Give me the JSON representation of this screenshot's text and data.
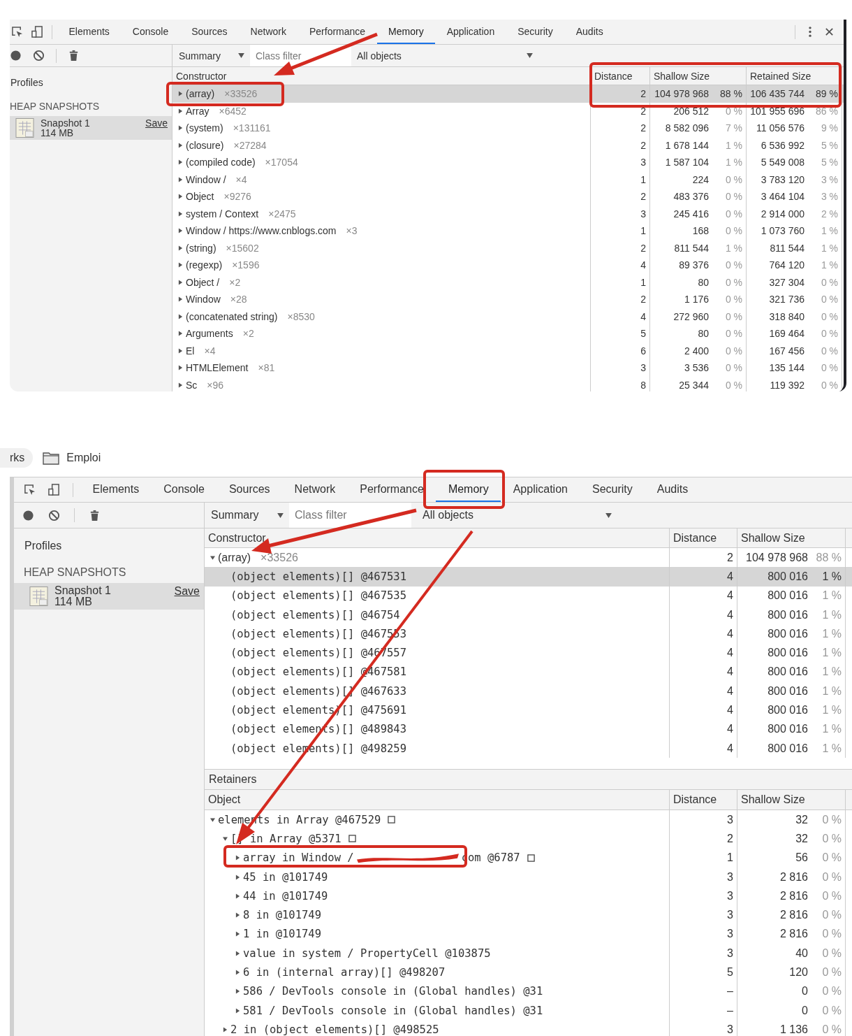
{
  "panels": [
    {
      "tabbar_controls": true,
      "tabs": [
        {
          "label": "Elements",
          "selected": false
        },
        {
          "label": "Console",
          "selected": false
        },
        {
          "label": "Sources",
          "selected": false
        },
        {
          "label": "Network",
          "selected": false
        },
        {
          "label": "Performance",
          "selected": false
        },
        {
          "label": "Memory",
          "selected": true
        },
        {
          "label": "Application",
          "selected": false
        },
        {
          "label": "Security",
          "selected": false
        },
        {
          "label": "Audits",
          "selected": false
        }
      ],
      "toolbar": {
        "view": "Summary",
        "filter_placeholder": "Class filter",
        "scope": "All objects"
      },
      "sidebar": {
        "title": "Profiles",
        "section": "HEAP SNAPSHOTS",
        "snapshot": {
          "name": "Snapshot 1",
          "size": "114 MB",
          "action": "Save",
          "selected": true
        }
      },
      "tables": [
        {
          "columns": [
            "Constructor",
            "Distance",
            "Shallow Size",
            "Retained Size"
          ],
          "rows": [
            {
              "kind": "constructor",
              "name": "(array)",
              "count": "×33526",
              "distance": "2",
              "shallow": "104 978 968",
              "shallow_pct": "88 %",
              "retained": "106 435 744",
              "retained_pct": "89 %",
              "selected": true,
              "expanded": false
            },
            {
              "kind": "constructor",
              "name": "Array",
              "count": "×6452",
              "distance": "2",
              "shallow": "206 512",
              "shallow_pct": "0 %",
              "retained": "101 955 696",
              "retained_pct": "86 %",
              "selected": false,
              "expanded": false
            },
            {
              "kind": "constructor",
              "name": "(system)",
              "count": "×131161",
              "distance": "2",
              "shallow": "8 582 096",
              "shallow_pct": "7 %",
              "retained": "11 056 576",
              "retained_pct": "9 %",
              "selected": false,
              "expanded": false
            },
            {
              "kind": "constructor",
              "name": "(closure)",
              "count": "×27284",
              "distance": "2",
              "shallow": "1 678 144",
              "shallow_pct": "1 %",
              "retained": "6 536 992",
              "retained_pct": "5 %",
              "selected": false,
              "expanded": false
            },
            {
              "kind": "constructor",
              "name": "(compiled code)",
              "count": "×17054",
              "distance": "3",
              "shallow": "1 587 104",
              "shallow_pct": "1 %",
              "retained": "5 549 008",
              "retained_pct": "5 %",
              "selected": false,
              "expanded": false
            },
            {
              "kind": "constructor",
              "name": "Window /",
              "count": "×4",
              "distance": "1",
              "shallow": "224",
              "shallow_pct": "0 %",
              "retained": "3 783 120",
              "retained_pct": "3 %",
              "selected": false,
              "expanded": false
            },
            {
              "kind": "constructor",
              "name": "Object",
              "count": "×9276",
              "distance": "2",
              "shallow": "483 376",
              "shallow_pct": "0 %",
              "retained": "3 464 104",
              "retained_pct": "3 %",
              "selected": false,
              "expanded": false
            },
            {
              "kind": "constructor",
              "name": "system / Context",
              "count": "×2475",
              "distance": "3",
              "shallow": "245 416",
              "shallow_pct": "0 %",
              "retained": "2 914 000",
              "retained_pct": "2 %",
              "selected": false,
              "expanded": false
            },
            {
              "kind": "constructor",
              "name": "Window / https://www.cnblogs.com",
              "count": "×3",
              "distance": "1",
              "shallow": "168",
              "shallow_pct": "0 %",
              "retained": "1 073 760",
              "retained_pct": "1 %",
              "selected": false,
              "expanded": false
            },
            {
              "kind": "constructor",
              "name": "(string)",
              "count": "×15602",
              "distance": "2",
              "shallow": "811 544",
              "shallow_pct": "1 %",
              "retained": "811 544",
              "retained_pct": "1 %",
              "selected": false,
              "expanded": false
            },
            {
              "kind": "constructor",
              "name": "(regexp)",
              "count": "×1596",
              "distance": "4",
              "shallow": "89 376",
              "shallow_pct": "0 %",
              "retained": "764 120",
              "retained_pct": "1 %",
              "selected": false,
              "expanded": false
            },
            {
              "kind": "constructor",
              "name": "Object /",
              "count": "×2",
              "distance": "1",
              "shallow": "80",
              "shallow_pct": "0 %",
              "retained": "327 304",
              "retained_pct": "0 %",
              "selected": false,
              "expanded": false
            },
            {
              "kind": "constructor",
              "name": "Window",
              "count": "×28",
              "distance": "2",
              "shallow": "1 176",
              "shallow_pct": "0 %",
              "retained": "321 736",
              "retained_pct": "0 %",
              "selected": false,
              "expanded": false
            },
            {
              "kind": "constructor",
              "name": "(concatenated string)",
              "count": "×8530",
              "distance": "4",
              "shallow": "272 960",
              "shallow_pct": "0 %",
              "retained": "318 840",
              "retained_pct": "0 %",
              "selected": false,
              "expanded": false
            },
            {
              "kind": "constructor",
              "name": "Arguments",
              "count": "×2",
              "distance": "5",
              "shallow": "80",
              "shallow_pct": "0 %",
              "retained": "169 464",
              "retained_pct": "0 %",
              "selected": false,
              "expanded": false
            },
            {
              "kind": "constructor",
              "name": "El",
              "count": "×4",
              "distance": "6",
              "shallow": "2 400",
              "shallow_pct": "0 %",
              "retained": "167 456",
              "retained_pct": "0 %",
              "selected": false,
              "expanded": false
            },
            {
              "kind": "constructor",
              "name": "HTMLElement",
              "count": "×81",
              "distance": "3",
              "shallow": "3 536",
              "shallow_pct": "0 %",
              "retained": "135 144",
              "retained_pct": "0 %",
              "selected": false,
              "expanded": false
            },
            {
              "kind": "constructor",
              "name": "Sc",
              "count": "×96",
              "distance": "8",
              "shallow": "25 344",
              "shallow_pct": "0 %",
              "retained": "119 392",
              "retained_pct": "0 %",
              "selected": false,
              "expanded": false
            }
          ]
        }
      ]
    },
    {
      "breadcrumbs": [
        {
          "kind": "pill",
          "label": "rks"
        },
        {
          "kind": "folder",
          "label": "Emploi"
        }
      ],
      "tabs": [
        {
          "label": "Elements",
          "selected": false
        },
        {
          "label": "Console",
          "selected": false
        },
        {
          "label": "Sources",
          "selected": false
        },
        {
          "label": "Network",
          "selected": false
        },
        {
          "label": "Performance",
          "selected": false
        },
        {
          "label": "Memory",
          "selected": true
        },
        {
          "label": "Application",
          "selected": false
        },
        {
          "label": "Security",
          "selected": false
        },
        {
          "label": "Audits",
          "selected": false
        }
      ],
      "toolbar": {
        "view": "Summary",
        "filter_placeholder": "Class filter",
        "scope": "All objects"
      },
      "sidebar": {
        "title": "Profiles",
        "section": "HEAP SNAPSHOTS",
        "snapshot": {
          "name": "Snapshot 1",
          "size": "114 MB",
          "action": "Save",
          "selected": true
        }
      },
      "tables": [
        {
          "columns": [
            "Constructor",
            "Distance",
            "Shallow Size"
          ],
          "rows": [
            {
              "kind": "constructor",
              "name": "(array)",
              "count": "×33526",
              "distance": "2",
              "shallow": "104 978 968",
              "shallow_pct": "88 %",
              "selected": false,
              "expanded": true,
              "children": [
                {
                  "kind": "object",
                  "name": "(object elements)[] @467531",
                  "distance": "4",
                  "shallow": "800 016",
                  "shallow_pct": "1 %",
                  "selected": true
                },
                {
                  "kind": "object",
                  "name": "(object elements)[] @467535",
                  "distance": "4",
                  "shallow": "800 016",
                  "shallow_pct": "1 %",
                  "selected": false
                },
                {
                  "kind": "object",
                  "name": "(object elements)[] @46754",
                  "distance": "4",
                  "shallow": "800 016",
                  "shallow_pct": "1 %",
                  "selected": false
                },
                {
                  "kind": "object",
                  "name": "(object elements)[] @467553",
                  "distance": "4",
                  "shallow": "800 016",
                  "shallow_pct": "1 %",
                  "selected": false
                },
                {
                  "kind": "object",
                  "name": "(object elements)[] @467557",
                  "distance": "4",
                  "shallow": "800 016",
                  "shallow_pct": "1 %",
                  "selected": false
                },
                {
                  "kind": "object",
                  "name": "(object elements)[] @467581",
                  "distance": "4",
                  "shallow": "800 016",
                  "shallow_pct": "1 %",
                  "selected": false
                },
                {
                  "kind": "object",
                  "name": "(object elements)[] @467633",
                  "distance": "4",
                  "shallow": "800 016",
                  "shallow_pct": "1 %",
                  "selected": false
                },
                {
                  "kind": "object",
                  "name": "(object elements)[] @475691",
                  "distance": "4",
                  "shallow": "800 016",
                  "shallow_pct": "1 %",
                  "selected": false
                },
                {
                  "kind": "object",
                  "name": "(object elements)[] @489843",
                  "distance": "4",
                  "shallow": "800 016",
                  "shallow_pct": "1 %",
                  "selected": false
                },
                {
                  "kind": "object",
                  "name": "(object elements)[] @498259",
                  "distance": "4",
                  "shallow": "800 016",
                  "shallow_pct": "1 %",
                  "selected": false
                }
              ]
            }
          ]
        },
        {
          "title": "Retainers",
          "columns": [
            "Object",
            "Distance",
            "Shallow Size"
          ],
          "rows": [
            {
              "kind": "object",
              "name": "elements in Array @467529",
              "reveal": true,
              "distance": "3",
              "shallow": "32",
              "shallow_pct": "0 %",
              "selected": false,
              "expanded": true,
              "children": [
                {
                  "kind": "object",
                  "name": "[] in Array @5371",
                  "reveal": true,
                  "distance": "2",
                  "shallow": "32",
                  "shallow_pct": "0 %",
                  "selected": false,
                  "expanded": true,
                  "children": [
                    {
                      "kind": "object",
                      "name": "array in Window /",
                      "tail": "com @6787",
                      "reveal": true,
                      "distance": "1",
                      "shallow": "56",
                      "shallow_pct": "0 %",
                      "selected": false,
                      "expanded": false
                    },
                    {
                      "kind": "object",
                      "name": "45 in  @101749",
                      "distance": "3",
                      "shallow": "2 816",
                      "shallow_pct": "0 %",
                      "selected": false,
                      "expanded": false
                    },
                    {
                      "kind": "object",
                      "name": "44 in  @101749",
                      "distance": "3",
                      "shallow": "2 816",
                      "shallow_pct": "0 %",
                      "selected": false,
                      "expanded": false
                    },
                    {
                      "kind": "object",
                      "name": "8 in  @101749",
                      "distance": "3",
                      "shallow": "2 816",
                      "shallow_pct": "0 %",
                      "selected": false,
                      "expanded": false
                    },
                    {
                      "kind": "object",
                      "name": "1 in  @101749",
                      "distance": "3",
                      "shallow": "2 816",
                      "shallow_pct": "0 %",
                      "selected": false,
                      "expanded": false
                    },
                    {
                      "kind": "object",
                      "name": "value in system / PropertyCell @103875",
                      "distance": "3",
                      "shallow": "40",
                      "shallow_pct": "0 %",
                      "selected": false,
                      "expanded": false
                    },
                    {
                      "kind": "object",
                      "name": "6 in (internal array)[] @498207",
                      "distance": "5",
                      "shallow": "120",
                      "shallow_pct": "0 %",
                      "selected": false,
                      "expanded": false
                    },
                    {
                      "kind": "object",
                      "name": "586 / DevTools console in (Global handles) @31",
                      "distance": "–",
                      "shallow": "0",
                      "shallow_pct": "0 %",
                      "selected": false,
                      "expanded": false
                    },
                    {
                      "kind": "object",
                      "name": "581 / DevTools console in (Global handles) @31",
                      "distance": "–",
                      "shallow": "0",
                      "shallow_pct": "0 %",
                      "selected": false,
                      "expanded": false
                    }
                  ]
                },
                {
                  "kind": "object",
                  "name": "2 in (object elements)[] @498525",
                  "distance": "3",
                  "shallow": "1 136",
                  "shallow_pct": "0 %",
                  "selected": false,
                  "expanded": false
                }
              ]
            }
          ]
        }
      ]
    }
  ]
}
